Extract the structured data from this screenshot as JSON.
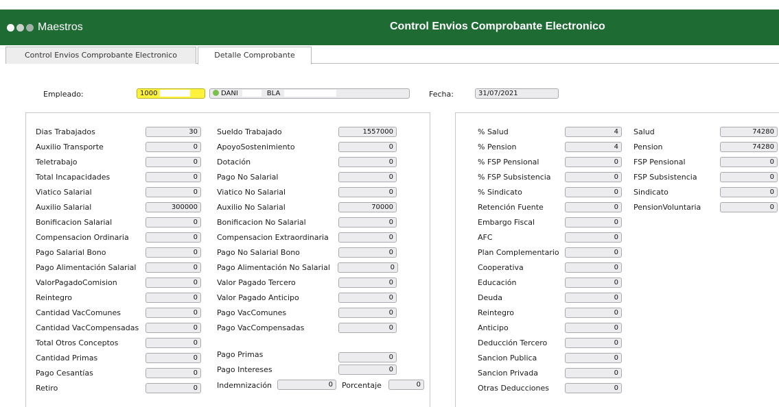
{
  "header": {
    "module": "Maestros",
    "title": "Control Envios Comprobante Electronico"
  },
  "tabs": [
    {
      "label": "Control Envios Comprobante Electronico"
    },
    {
      "label": "Detalle Comprobante"
    }
  ],
  "employee": {
    "label": "Empleado:",
    "id": "1000",
    "name_first": "DANI",
    "name_last": "BLA",
    "date_label": "Fecha:",
    "date": "31/07/2021"
  },
  "accruals": {
    "col1": [
      {
        "label": "Dias Trabajados",
        "value": "30"
      },
      {
        "label": "Auxilio Transporte",
        "value": "0"
      },
      {
        "label": "Teletrabajo",
        "value": "0"
      },
      {
        "label": "Total Incapacidades",
        "value": "0"
      },
      {
        "label": "Viatico Salarial",
        "value": "0"
      },
      {
        "label": "Auxilio Salarial",
        "value": "300000"
      },
      {
        "label": "Bonificacion Salarial",
        "value": "0"
      },
      {
        "label": "Compensacion Ordinaria",
        "value": "0"
      },
      {
        "label": "Pago Salarial Bono",
        "value": "0"
      },
      {
        "label": "Pago Alimentación Salarial",
        "value": "0"
      },
      {
        "label": "ValorPagadoComision",
        "value": "0"
      },
      {
        "label": "Reintegro",
        "value": "0"
      },
      {
        "label": "Cantidad VacComunes",
        "value": "0"
      },
      {
        "label": "Cantidad VacCompensadas",
        "value": "0"
      },
      {
        "label": "Total Otros Conceptos",
        "value": "0"
      },
      {
        "label": "Cantidad Primas",
        "value": "0"
      },
      {
        "label": "Pago Cesantías",
        "value": "0"
      },
      {
        "label": "Retiro",
        "value": "0"
      }
    ],
    "col2": [
      {
        "label": "Sueldo Trabajado",
        "value": "1557000"
      },
      {
        "label": "ApoyoSostenimiento",
        "value": "0"
      },
      {
        "label": "Dotación",
        "value": "0"
      },
      {
        "label": "Pago No Salarial",
        "value": "0"
      },
      {
        "label": "Viatico No Salarial",
        "value": "0"
      },
      {
        "label": "Auxilio No Salarial",
        "value": "70000"
      },
      {
        "label": "Bonificacion No Salarial",
        "value": "0"
      },
      {
        "label": "Compensacion Extraordinaria",
        "value": "0"
      },
      {
        "label": "Pago No Salarial Bono",
        "value": "0"
      },
      {
        "label": "Pago Alimentación No Salarial",
        "value": "0"
      },
      {
        "label": "Valor Pagado Tercero",
        "value": "0"
      },
      {
        "label": "Valor Pagado Anticipo",
        "value": "0"
      },
      {
        "label": "Pago VacComunes",
        "value": "0"
      },
      {
        "label": "Pago VacCompensadas",
        "value": "0"
      },
      {
        "label": "Pago Primas",
        "value": "0"
      },
      {
        "label": "Pago Intereses",
        "value": "0"
      }
    ],
    "indemnizacion": {
      "label": "Indemnización",
      "value": "0"
    },
    "porcentaje": {
      "label": "Porcentaje",
      "value": "0"
    }
  },
  "deductions": {
    "col1": [
      {
        "label": "% Salud",
        "value": "4"
      },
      {
        "label": "% Pension",
        "value": "4"
      },
      {
        "label": "% FSP Pensional",
        "value": "0"
      },
      {
        "label": "% FSP Subsistencia",
        "value": "0"
      },
      {
        "label": "% Sindicato",
        "value": "0"
      },
      {
        "label": "Retención Fuente",
        "value": "0"
      },
      {
        "label": "Embargo Fiscal",
        "value": "0"
      },
      {
        "label": "AFC",
        "value": "0"
      },
      {
        "label": "Plan Complementario",
        "value": "0"
      },
      {
        "label": "Cooperativa",
        "value": "0"
      },
      {
        "label": "Educación",
        "value": "0"
      },
      {
        "label": "Deuda",
        "value": "0"
      },
      {
        "label": "Reintegro",
        "value": "0"
      },
      {
        "label": "Anticipo",
        "value": "0"
      },
      {
        "label": "Deducción Tercero",
        "value": "0"
      },
      {
        "label": "Sancion Publica",
        "value": "0"
      },
      {
        "label": "Sancion Privada",
        "value": "0"
      },
      {
        "label": "Otras Deducciones",
        "value": "0"
      }
    ],
    "col2": [
      {
        "label": "Salud",
        "value": "74280"
      },
      {
        "label": "Pension",
        "value": "74280"
      },
      {
        "label": "FSP Pensional",
        "value": "0"
      },
      {
        "label": "FSP Subsistencia",
        "value": "0"
      },
      {
        "label": "Sindicato",
        "value": "0"
      },
      {
        "label": "PensionVoluntaria",
        "value": "0"
      }
    ]
  }
}
